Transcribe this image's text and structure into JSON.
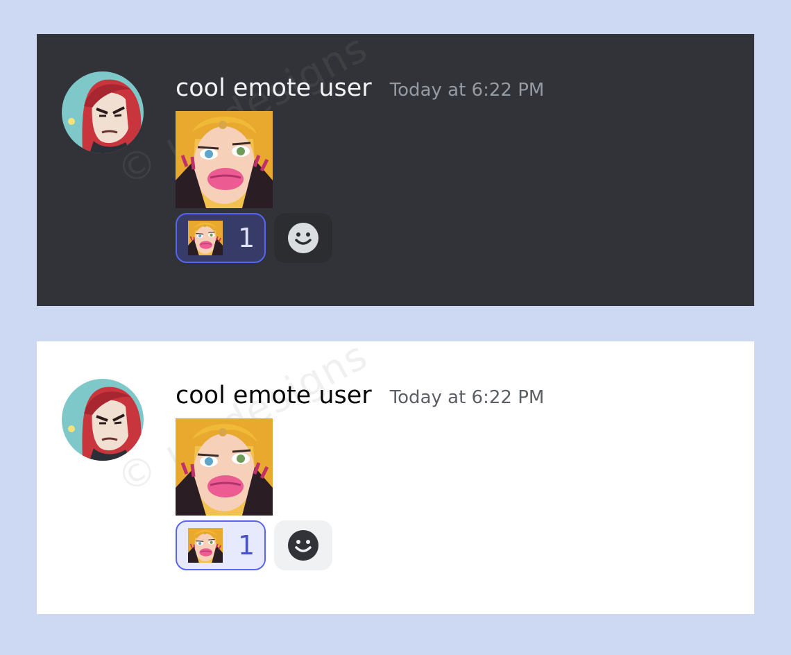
{
  "messages": [
    {
      "theme": "dark",
      "username": "cool emote user",
      "timestamp": "Today at 6:22 PM",
      "watermark": "© uv designs",
      "reactions": [
        {
          "emote": "pouty-lips-emote",
          "count": "1"
        }
      ],
      "add_reaction_icon": "smiley-icon"
    },
    {
      "theme": "light",
      "username": "cool emote user",
      "timestamp": "Today at 6:22 PM",
      "watermark": "© uv designs",
      "reactions": [
        {
          "emote": "pouty-lips-emote",
          "count": "1"
        }
      ],
      "add_reaction_icon": "smiley-icon"
    }
  ],
  "colors": {
    "background": "#cdd8f3",
    "dark_panel": "#313338",
    "light_panel": "#ffffff",
    "reaction_border": "#5865f2"
  }
}
